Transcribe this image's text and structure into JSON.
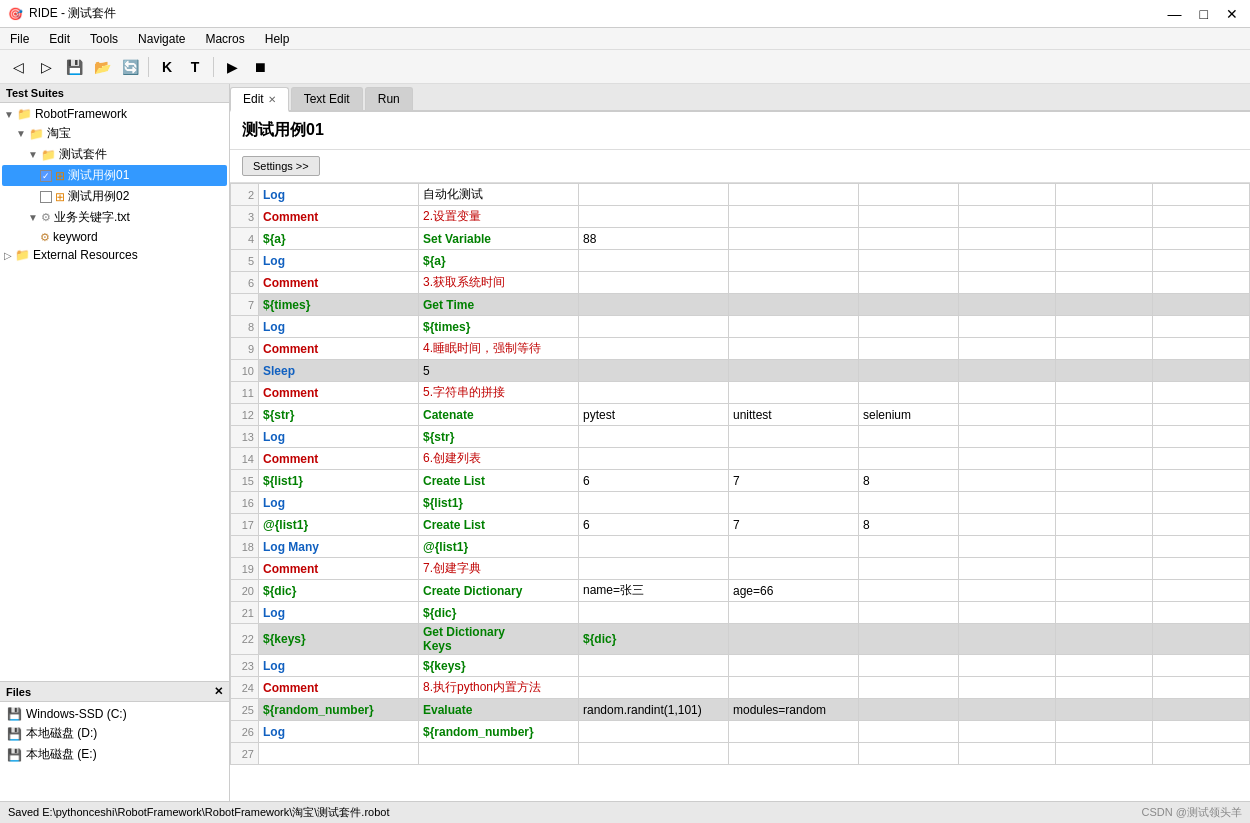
{
  "titlebar": {
    "title": "RIDE - 测试套件",
    "icon": "🎯",
    "controls": [
      "—",
      "□",
      "✕"
    ]
  },
  "menubar": {
    "items": [
      "File",
      "Edit",
      "Tools",
      "Navigate",
      "Macros",
      "Help"
    ]
  },
  "toolbar": {
    "buttons": [
      "◀▶",
      "💾",
      "📂",
      "✂",
      "📋",
      "K",
      "T",
      "▶",
      "⏹"
    ]
  },
  "left_panel": {
    "header": "Test Suites",
    "tree": [
      {
        "label": "RobotFramework",
        "indent": 0,
        "type": "folder",
        "expanded": true
      },
      {
        "label": "淘宝",
        "indent": 1,
        "type": "folder",
        "expanded": true
      },
      {
        "label": "测试套件",
        "indent": 2,
        "type": "folder",
        "expanded": true
      },
      {
        "label": "测试用例01",
        "indent": 3,
        "type": "testcase",
        "selected": true,
        "checked": true
      },
      {
        "label": "测试用例02",
        "indent": 3,
        "type": "testcase",
        "checked": false
      },
      {
        "label": "业务关键字.txt",
        "indent": 2,
        "type": "file"
      },
      {
        "label": "keyword",
        "indent": 3,
        "type": "keyword"
      },
      {
        "label": "External Resources",
        "indent": 0,
        "type": "folder-ext"
      }
    ]
  },
  "files_panel": {
    "header": "Files",
    "items": [
      {
        "label": "Windows-SSD (C:)",
        "icon": "💾"
      },
      {
        "label": "本地磁盘 (D:)",
        "icon": "💾"
      },
      {
        "label": "本地磁盘 (E:)",
        "icon": "💾"
      }
    ]
  },
  "tabs": [
    {
      "label": "Edit",
      "active": true,
      "closeable": true
    },
    {
      "label": "Text Edit",
      "active": false,
      "closeable": false
    },
    {
      "label": "Run",
      "active": false,
      "closeable": false
    }
  ],
  "case_title": "测试用例01",
  "settings_btn": "Settings >>",
  "table": {
    "rows": [
      {
        "num": "2",
        "keyword": "Log",
        "kw_class": "kw-blue",
        "arg1": "自动化测试",
        "arg1_class": "",
        "arg2": "",
        "arg3": "",
        "arg4": "",
        "gray": false
      },
      {
        "num": "3",
        "keyword": "Comment",
        "kw_class": "kw-red",
        "arg1": "2.设置变量",
        "arg1_class": "comment-red",
        "arg2": "",
        "arg3": "",
        "arg4": "",
        "gray": false
      },
      {
        "num": "4",
        "keyword": "${a}",
        "kw_class": "var-green",
        "arg1": "Set Variable",
        "arg1_class": "kw-green",
        "arg2": "88",
        "arg3": "",
        "arg4": "",
        "gray": false
      },
      {
        "num": "5",
        "keyword": "Log",
        "kw_class": "kw-blue",
        "arg1": "${a}",
        "arg1_class": "var-green",
        "arg2": "",
        "arg3": "",
        "arg4": "",
        "gray": false
      },
      {
        "num": "6",
        "keyword": "Comment",
        "kw_class": "kw-red",
        "arg1": "3.获取系统时间",
        "arg1_class": "comment-red",
        "arg2": "",
        "arg3": "",
        "arg4": "",
        "gray": false
      },
      {
        "num": "7",
        "keyword": "${times}",
        "kw_class": "var-green",
        "arg1": "Get Time",
        "arg1_class": "kw-green",
        "arg2": "",
        "arg3": "",
        "arg4": "",
        "gray": true
      },
      {
        "num": "8",
        "keyword": "Log",
        "kw_class": "kw-blue",
        "arg1": "${times}",
        "arg1_class": "var-green",
        "arg2": "",
        "arg3": "",
        "arg4": "",
        "gray": false
      },
      {
        "num": "9",
        "keyword": "Comment",
        "kw_class": "kw-red",
        "arg1": "4.睡眠时间，强制等待",
        "arg1_class": "comment-red",
        "arg2": "",
        "arg3": "",
        "arg4": "",
        "gray": false
      },
      {
        "num": "10",
        "keyword": "Sleep",
        "kw_class": "kw-blue",
        "arg1": "5",
        "arg1_class": "",
        "arg2": "",
        "arg3": "",
        "arg4": "",
        "gray": true
      },
      {
        "num": "11",
        "keyword": "Comment",
        "kw_class": "kw-red",
        "arg1": "5.字符串的拼接",
        "arg1_class": "comment-red",
        "arg2": "",
        "arg3": "",
        "arg4": "",
        "gray": false
      },
      {
        "num": "12",
        "keyword": "${str}",
        "kw_class": "var-green",
        "arg1": "Catenate",
        "arg1_class": "kw-green",
        "arg2": "pytest",
        "arg3": "unittest",
        "arg4": "selenium",
        "gray": false
      },
      {
        "num": "13",
        "keyword": "Log",
        "kw_class": "kw-blue",
        "arg1": "${str}",
        "arg1_class": "var-green",
        "arg2": "",
        "arg3": "",
        "arg4": "",
        "gray": false
      },
      {
        "num": "14",
        "keyword": "Comment",
        "kw_class": "kw-red",
        "arg1": "6.创建列表",
        "arg1_class": "comment-red",
        "arg2": "",
        "arg3": "",
        "arg4": "",
        "gray": false
      },
      {
        "num": "15",
        "keyword": "${list1}",
        "kw_class": "var-green",
        "arg1": "Create List",
        "arg1_class": "kw-green",
        "arg2": "6",
        "arg3": "7",
        "arg4": "8",
        "gray": false
      },
      {
        "num": "16",
        "keyword": "Log",
        "kw_class": "kw-blue",
        "arg1": "${list1}",
        "arg1_class": "var-green",
        "arg2": "",
        "arg3": "",
        "arg4": "",
        "gray": false
      },
      {
        "num": "17",
        "keyword": "@{list1}",
        "kw_class": "var-green",
        "arg1": "Create List",
        "arg1_class": "kw-green",
        "arg2": "6",
        "arg3": "7",
        "arg4": "8",
        "gray": false
      },
      {
        "num": "18",
        "keyword": "Log Many",
        "kw_class": "kw-blue",
        "arg1": "@{list1}",
        "arg1_class": "var-green",
        "arg2": "",
        "arg3": "",
        "arg4": "",
        "gray": false
      },
      {
        "num": "19",
        "keyword": "Comment",
        "kw_class": "kw-red",
        "arg1": "7.创建字典",
        "arg1_class": "comment-red",
        "arg2": "",
        "arg3": "",
        "arg4": "",
        "gray": false
      },
      {
        "num": "20",
        "keyword": "${dic}",
        "kw_class": "var-green",
        "arg1": "Create Dictionary",
        "arg1_class": "kw-green",
        "arg2": "name=张三",
        "arg3": "age=66",
        "arg4": "",
        "gray": false
      },
      {
        "num": "21",
        "keyword": "Log",
        "kw_class": "kw-blue",
        "arg1": "${dic}",
        "arg1_class": "var-green",
        "arg2": "",
        "arg3": "",
        "arg4": "",
        "gray": false
      },
      {
        "num": "22",
        "keyword": "${keys}",
        "kw_class": "var-green",
        "arg1": "Get Dictionary\nKeys",
        "arg1_class": "kw-green",
        "arg2": "${dic}",
        "arg2_class": "var-green",
        "arg3": "",
        "arg4": "",
        "gray": true
      },
      {
        "num": "23",
        "keyword": "Log",
        "kw_class": "kw-blue",
        "arg1": "${keys}",
        "arg1_class": "var-green",
        "arg2": "",
        "arg3": "",
        "arg4": "",
        "gray": false
      },
      {
        "num": "24",
        "keyword": "Comment",
        "kw_class": "kw-red",
        "arg1": "8.执行python内置方法",
        "arg1_class": "comment-red",
        "arg2": "",
        "arg3": "",
        "arg4": "",
        "gray": false
      },
      {
        "num": "25",
        "keyword": "${random_number}",
        "kw_class": "var-green",
        "arg1": "Evaluate",
        "arg1_class": "kw-green",
        "arg2": "random.randint(1,101)",
        "arg3": "modules=random",
        "arg4": "",
        "gray": true
      },
      {
        "num": "26",
        "keyword": "Log",
        "kw_class": "kw-blue",
        "arg1": "${random_number}",
        "arg1_class": "var-green",
        "arg2": "",
        "arg3": "",
        "arg4": "",
        "gray": false
      },
      {
        "num": "27",
        "keyword": "",
        "kw_class": "",
        "arg1": "",
        "arg2": "",
        "arg3": "",
        "arg4": "",
        "gray": false
      }
    ]
  },
  "statusbar": {
    "text": "Saved E:\\pythonceshi\\RobotFramework\\RobotFramework\\淘宝\\测试套件.robot",
    "brand": "CSDN @测试领头羊"
  }
}
